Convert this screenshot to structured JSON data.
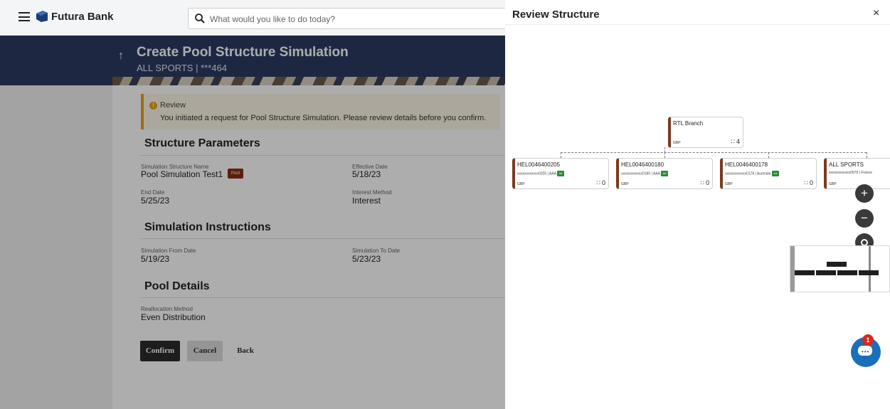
{
  "header": {
    "brand": "Futura Bank",
    "search_placeholder": "What would you like to do today?"
  },
  "page": {
    "title": "Create Pool Structure Simulation",
    "subtitle": "ALL SPORTS | ***464"
  },
  "review": {
    "title": "Review",
    "message": "You initiated a request for Pool Structure Simulation. Please review details before you confirm."
  },
  "structure_parameters": {
    "title": "Structure Parameters",
    "name_label": "Simulation Structure Name",
    "name_value": "Pool Simulation Test1",
    "pool_tag": "Pool",
    "effective_date_label": "Effective Date",
    "effective_date_value": "5/18/23",
    "end_date_label": "End Date",
    "end_date_value": "5/25/23",
    "interest_method_label": "Interest Method",
    "interest_method_value": "Interest"
  },
  "simulation_instructions": {
    "title": "Simulation Instructions",
    "from_label": "Simulation From Date",
    "from_value": "5/19/23",
    "to_label": "Simulation To Date",
    "to_value": "5/23/23"
  },
  "pool_details": {
    "title": "Pool Details",
    "method_label": "Reallocation Method",
    "method_value": "Even Distribution"
  },
  "actions": {
    "confirm": "Confirm",
    "cancel": "Cancel",
    "back": "Back"
  },
  "panel": {
    "title": "Review Structure",
    "close": "×",
    "root": {
      "name": "RTL Branch",
      "currency": "GBP",
      "children_count": "4"
    },
    "children": [
      {
        "name": "HEL0046400205",
        "account": "xxxxxxxxxxxx0205 | AAA",
        "tag": "Int",
        "currency": "GBP",
        "children_count": "0"
      },
      {
        "name": "HEL0046400180",
        "account": "xxxxxxxxxxxx0180 | AAA",
        "tag": "Int",
        "currency": "GBP",
        "children_count": "0"
      },
      {
        "name": "HEL0046400178",
        "account": "xxxxxxxxxxxx0178 | Australia",
        "tag": "Int",
        "currency": "GBP",
        "children_count": "0"
      },
      {
        "name": "ALL SPORTS",
        "account": "xxxxxxxxxxxx0078 | France",
        "tag": "",
        "currency": "GBP",
        "children_count": ""
      }
    ],
    "zoom_in": "+",
    "zoom_out": "−",
    "chat_badge": "1"
  }
}
